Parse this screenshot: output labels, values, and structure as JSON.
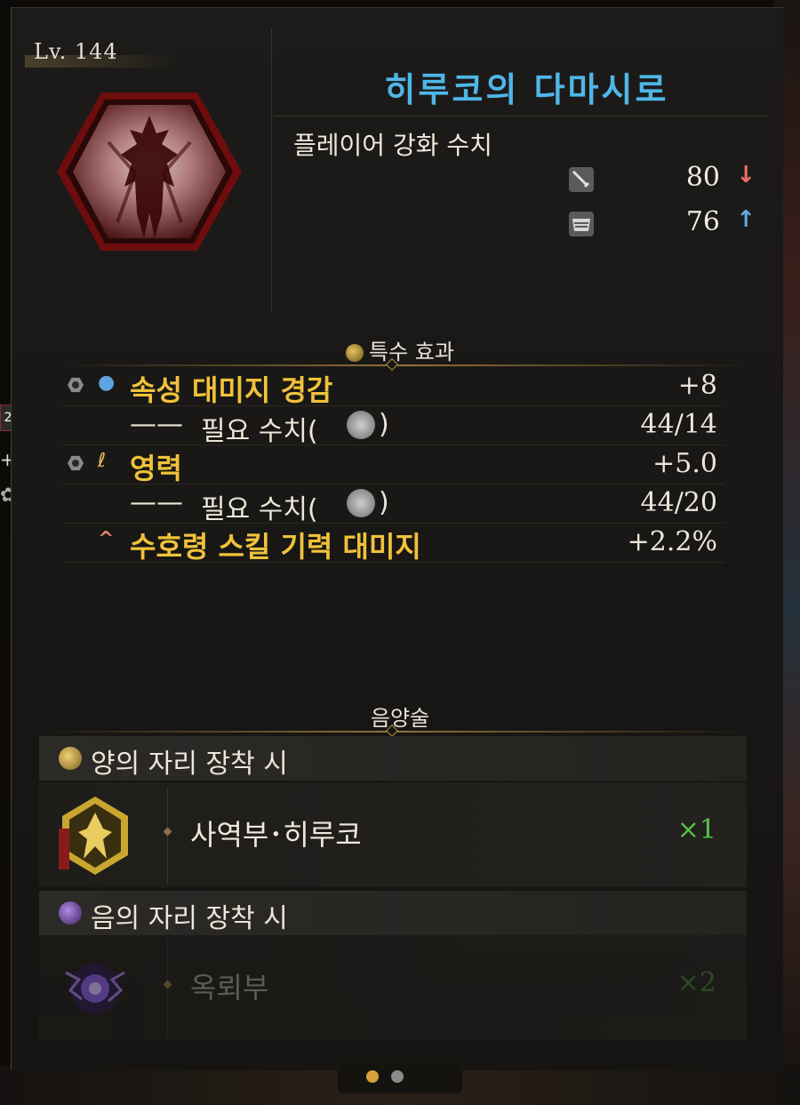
{
  "level": "Lv. 144",
  "title": "히루코의 다마시로",
  "subtitle": "플레이어 강화 수치",
  "stats": [
    {
      "icon": "sword-icon",
      "value": "80",
      "arrow": "down-arrow-icon",
      "arrow_color": "#e87062"
    },
    {
      "icon": "armor-icon",
      "value": "76",
      "arrow": "up-arrow-icon",
      "arrow_color": "#62a8e8"
    }
  ],
  "special": {
    "title": "특수 효과",
    "rows": [
      {
        "label": "속성 대미지 경감",
        "value": "+8"
      },
      {
        "prefix": "——",
        "label": "필요 수치(",
        "suffix": ")",
        "value": "44/14"
      },
      {
        "label": "영력",
        "value": "+5.0"
      },
      {
        "prefix": "——",
        "label": "필요 수치(",
        "suffix": ")",
        "value": "44/20"
      },
      {
        "label": "수호령 스킬 기력 대미지",
        "value": "+2.2%"
      }
    ]
  },
  "onmyo": {
    "title": "음양술",
    "yang_header": "양의 자리 장착 시",
    "yang_item": {
      "name": "사역부･히루코",
      "count": "×1"
    },
    "yin_header": "음의 자리 장착 시",
    "yin_item": {
      "name": "옥뢰부",
      "count": "×2"
    }
  },
  "colors": {
    "title": "#4fb6e8",
    "effect_label": "#f0c23a",
    "count_green": "#57c046",
    "page_dot_active": "#d7a23a",
    "page_dot_inactive": "#8a8a8a"
  },
  "pagination": {
    "total": 2,
    "active": 1
  }
}
